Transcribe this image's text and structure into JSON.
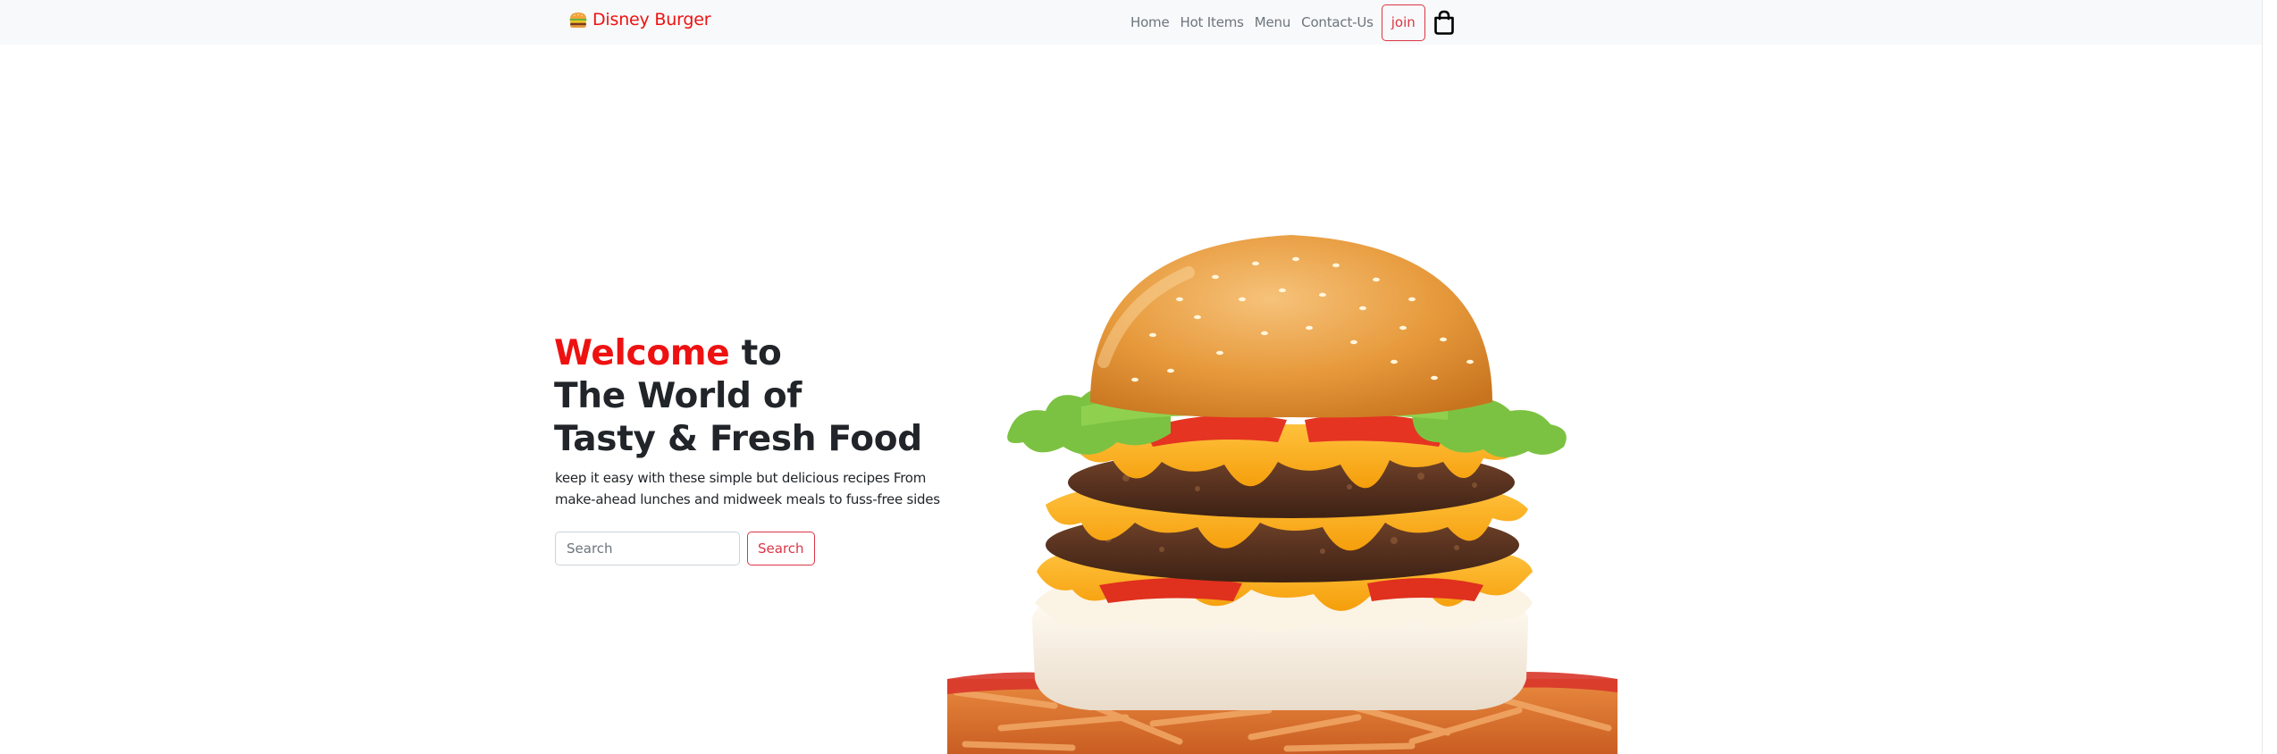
{
  "navbar": {
    "brand_icon": "burger-icon",
    "brand_text": "Disney Burger",
    "links": [
      "Home",
      "Hot Items",
      "Menu",
      "Contact-Us"
    ],
    "join_label": "join",
    "cart_icon": "shopping-bag-icon"
  },
  "hero": {
    "welcome": "Welcome",
    "line1_rest": " to",
    "line2": "The World of",
    "line3": "Tasty & Fresh Food",
    "description": "keep it easy with these simple but delicious recipes From make-ahead lunches and midweek meals to fuss-free sides",
    "search_placeholder": "Search",
    "search_button": "Search",
    "image": "burger-image"
  },
  "colors": {
    "accent": "#ee1111",
    "button_outline": "#dc3545",
    "navbar_bg": "#f8f9fa",
    "nav_link": "#6c757d",
    "heading": "#212529"
  }
}
